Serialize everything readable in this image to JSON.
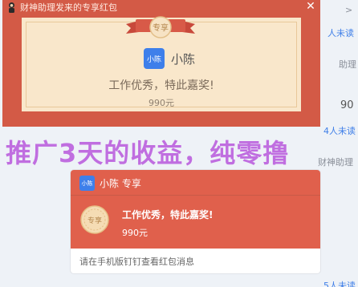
{
  "popup": {
    "title": "财神助理发来的专享红包",
    "close_symbol": "✕",
    "ribbon_text": "专享",
    "avatar_text": "小陈",
    "user_name": "小陈",
    "praise": "工作优秀，特此嘉奖!",
    "amount": "990元"
  },
  "overlay_text": "推广3天的收益，纯零撸",
  "bubble": {
    "avatar_text": "小陈",
    "title": "小陈 专享",
    "badge_text": "专享",
    "praise": "工作优秀，特此嘉奖!",
    "amount": "990元",
    "footer": "请在手机版钉钉查看红包消息"
  },
  "background": {
    "frag_top_arrow": ">",
    "frag_unread_1": "人未读",
    "frag_assistant_1": "助理",
    "frag_number": "90",
    "frag_unread_2": "4人未读",
    "frag_assistant_2": "财神助理",
    "frag_unread_3": "5人未读"
  }
}
